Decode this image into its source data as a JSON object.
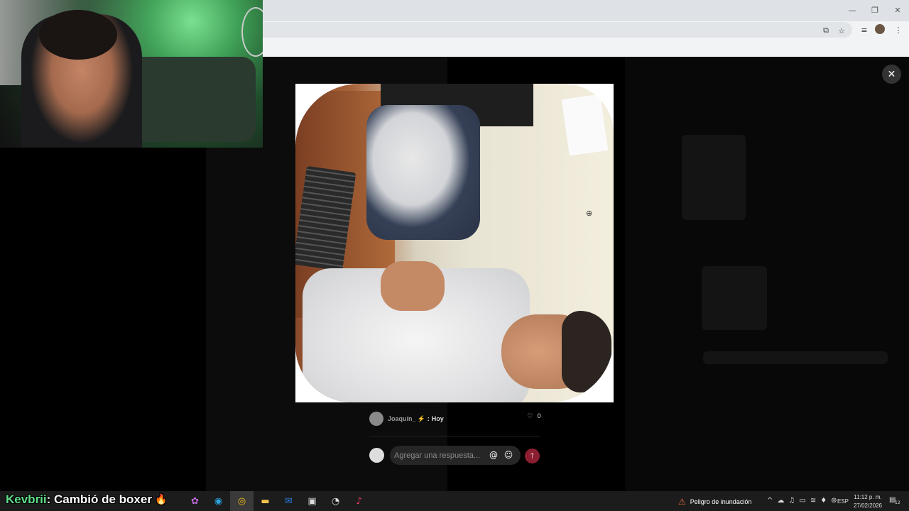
{
  "browser": {
    "window_controls": {
      "minimize": "—",
      "restore": "❐",
      "close": "✕"
    },
    "toolbar_icons": [
      "install-app-icon",
      "bookmark-star-icon",
      "tab-search-icon",
      "profile-avatar",
      "menu-icon"
    ]
  },
  "modal": {
    "author": "Joaquín_",
    "author_badge": "⚡",
    "time": "Hoy",
    "separator": ":",
    "likes": "0",
    "reply_placeholder": "Agregar una respuesta...",
    "close_label": "✕"
  },
  "overlay": {
    "caption_name": "Kevbrii",
    "caption_text": ": Cambió de boxer",
    "caption_emoji": "🔥"
  },
  "taskbar": {
    "alert_text": "Peligro de inundación",
    "language": "ESP",
    "time": "11:12 p. m.",
    "date": "27/02/2026",
    "notification_count": "12"
  },
  "colors": {
    "send_button": "#8b1e30",
    "caption_name": "#5fe08a",
    "alert_icon": "#e06a3a"
  }
}
